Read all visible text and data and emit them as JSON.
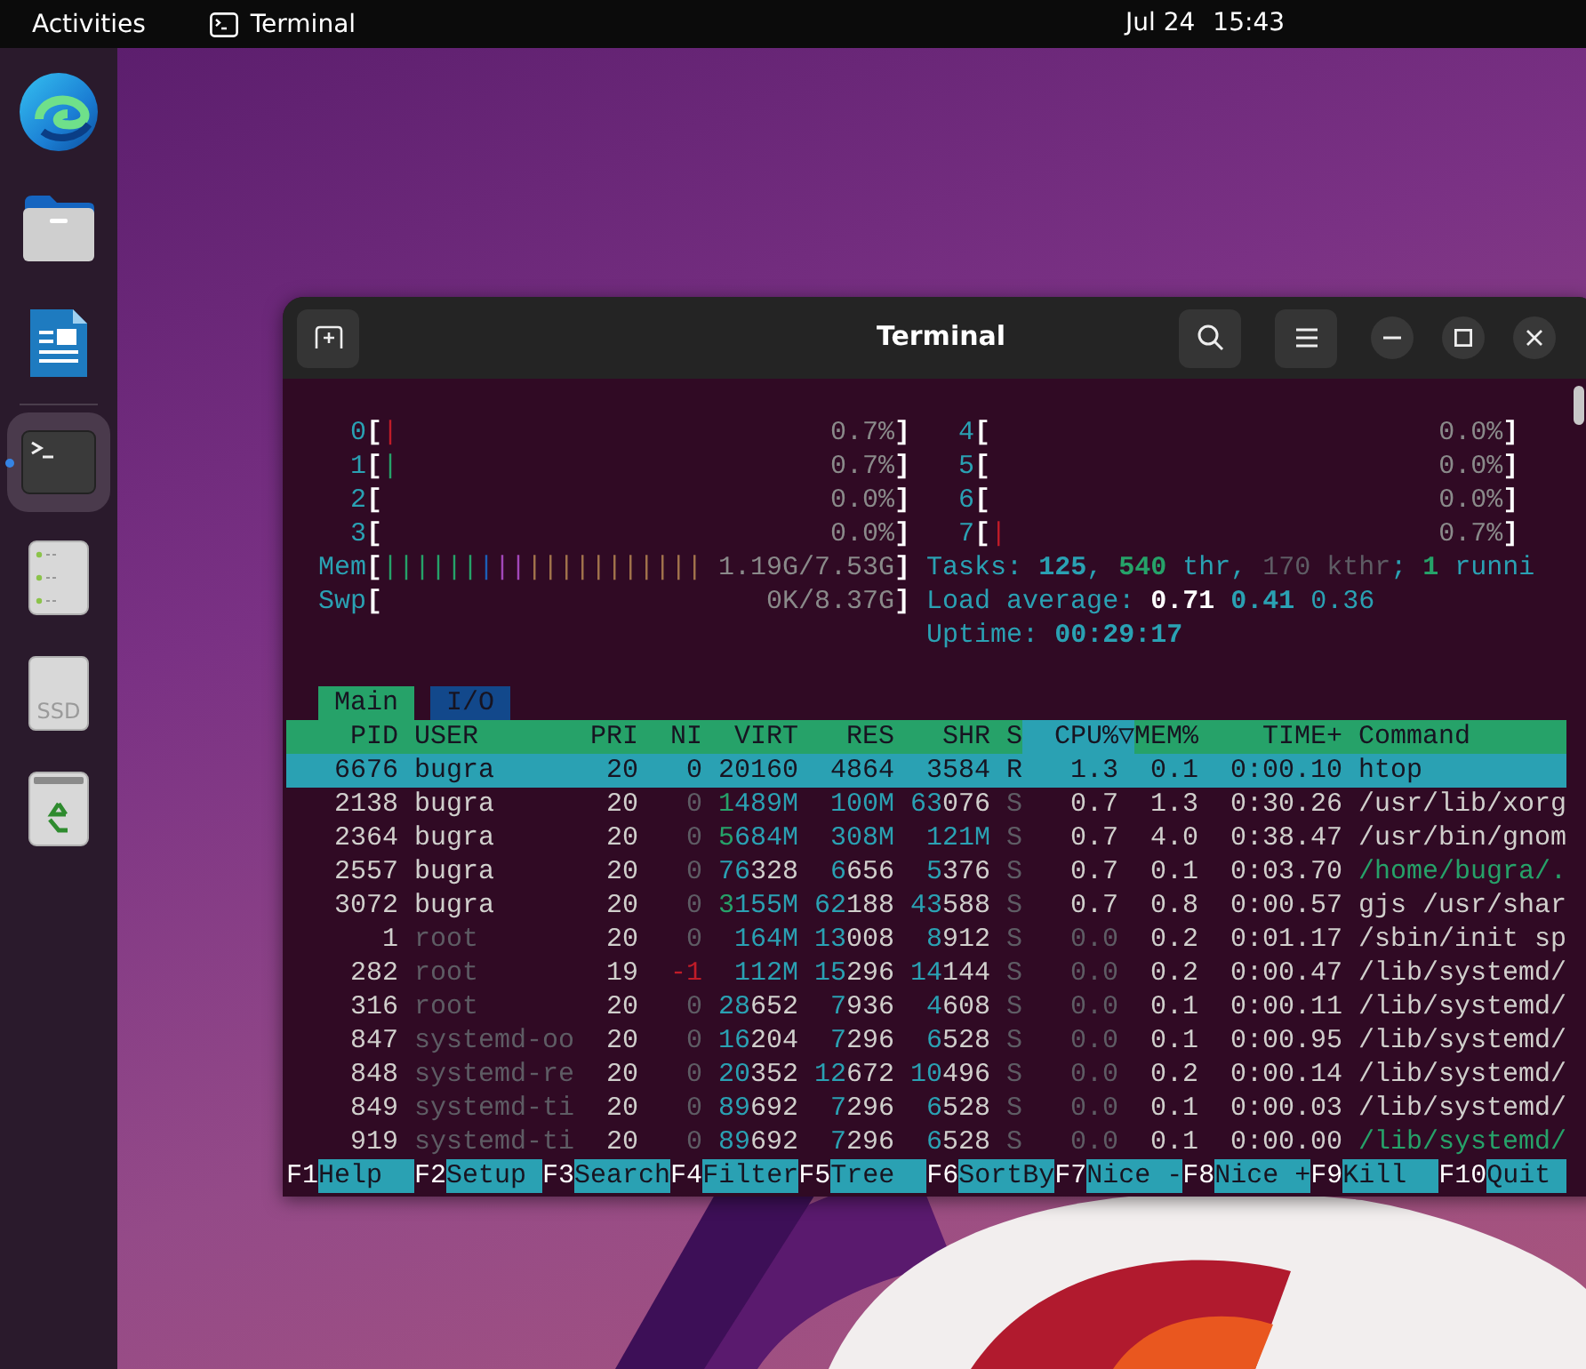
{
  "top_bar": {
    "activities": "Activities",
    "app": "Terminal",
    "date": "Jul 24",
    "time": "15:43"
  },
  "dock": [
    {
      "kind": "browser",
      "running": false
    },
    {
      "kind": "files",
      "running": false
    },
    {
      "kind": "writer",
      "running": false
    },
    {
      "kind": "terminal",
      "running": true
    },
    {
      "kind": "drive",
      "running": false
    },
    {
      "kind": "ssd",
      "label": "SSD",
      "running": false
    },
    {
      "kind": "trash",
      "running": false
    }
  ],
  "window": {
    "title": "Terminal"
  },
  "meters_left": [
    {
      "label": "0",
      "open": "[",
      "close": "]",
      "reading": "0.7%",
      "segments": [
        {
          "color": "#c01c28",
          "text": "|"
        }
      ]
    },
    {
      "label": "1",
      "open": "[",
      "close": "]",
      "reading": "0.7%",
      "segments": [
        {
          "color": "#26a269",
          "text": "|"
        }
      ]
    },
    {
      "label": "2",
      "open": "[",
      "close": "]",
      "reading": "0.0%"
    },
    {
      "label": "3",
      "open": "[",
      "close": "]",
      "reading": "0.0%"
    },
    {
      "label": "Mem",
      "open": "[",
      "close": "]",
      "reading": "1.19G/7.53G",
      "segments": [
        {
          "color": "#26a269",
          "text": "||||||"
        },
        {
          "color": "#1c5fb8",
          "text": "|"
        },
        {
          "color": "#a347ba",
          "text": "||"
        },
        {
          "color": "#a2734c",
          "text": "|||||||||||"
        }
      ]
    },
    {
      "label": "Swp",
      "open": "[",
      "close": "]",
      "reading": "0K/8.37G"
    }
  ],
  "meters_right": [
    {
      "label": "4",
      "open": "[",
      "close": "]",
      "reading": "0.0%"
    },
    {
      "label": "5",
      "open": "[",
      "close": "]",
      "reading": "0.0%"
    },
    {
      "label": "6",
      "open": "[",
      "close": "]",
      "reading": "0.0%"
    },
    {
      "label": "7",
      "open": "[",
      "close": "]",
      "reading": "0.7%",
      "segments": [
        {
          "color": "#c01c28",
          "text": "|"
        }
      ]
    }
  ],
  "summary": [
    [
      {
        "text": "Tasks: ",
        "kind": "label"
      },
      {
        "text": "125",
        "kind": "value"
      },
      {
        "text": ", ",
        "kind": "label"
      },
      {
        "text": "540",
        "kind": "value_green"
      },
      {
        "text": " thr, ",
        "kind": "label"
      },
      {
        "text": "170 kthr",
        "kind": "dim"
      },
      {
        "text": "; ",
        "kind": "label"
      },
      {
        "text": "1",
        "kind": "value_green"
      },
      {
        "text": " runni",
        "kind": "label"
      }
    ],
    [
      {
        "text": "Load average: ",
        "kind": "label"
      },
      {
        "text": "0.71",
        "kind": "value_white"
      },
      {
        "text": " 0.41",
        "kind": "value"
      },
      {
        "text": " 0.36",
        "kind": "label"
      }
    ],
    [
      {
        "text": "Uptime: ",
        "kind": "label"
      },
      {
        "text": "00:29:17",
        "kind": "value"
      }
    ]
  ],
  "tabs": [
    {
      "label": "Main",
      "selected": true
    },
    {
      "label": "I/O",
      "selected": false
    }
  ],
  "columns": [
    {
      "label": "PID",
      "sorted": false
    },
    {
      "label": "USER",
      "sorted": false
    },
    {
      "label": "PRI",
      "sorted": false
    },
    {
      "label": "NI",
      "sorted": false
    },
    {
      "label": "VIRT",
      "sorted": false
    },
    {
      "label": "RES",
      "sorted": false
    },
    {
      "label": "SHR",
      "sorted": false
    },
    {
      "label": "S",
      "sorted": false
    },
    {
      "label": "CPU%▽",
      "sorted": true
    },
    {
      "label": "MEM%",
      "sorted": false
    },
    {
      "label": "TIME+",
      "sorted": false
    },
    {
      "label": "Command",
      "sorted": false
    }
  ],
  "processes": [
    {
      "pid": "6676",
      "user": "bugra",
      "pri": "20",
      "ni": "0",
      "virt": "20160",
      "res": "4864",
      "shr": "3584",
      "state": "R",
      "cpu": "1.3",
      "mem": "0.1",
      "time": "0:00.10",
      "command": "htop",
      "selected": true,
      "dimmed_user": false,
      "thread": false
    },
    {
      "pid": "2138",
      "user": "bugra",
      "pri": "20",
      "ni": "0",
      "virt": "1489M",
      "res": "100M",
      "shr": "63076",
      "state": "S",
      "cpu": "0.7",
      "mem": "1.3",
      "time": "0:30.26",
      "command": "/usr/lib/xorg",
      "selected": false,
      "dimmed_user": false,
      "thread": false
    },
    {
      "pid": "2364",
      "user": "bugra",
      "pri": "20",
      "ni": "0",
      "virt": "5684M",
      "res": "308M",
      "shr": "121M",
      "state": "S",
      "cpu": "0.7",
      "mem": "4.0",
      "time": "0:38.47",
      "command": "/usr/bin/gnom",
      "selected": false,
      "dimmed_user": false,
      "thread": false
    },
    {
      "pid": "2557",
      "user": "bugra",
      "pri": "20",
      "ni": "0",
      "virt": "76328",
      "res": "6656",
      "shr": "5376",
      "state": "S",
      "cpu": "0.7",
      "mem": "0.1",
      "time": "0:03.70",
      "command": "/home/bugra/.",
      "selected": false,
      "dimmed_user": false,
      "thread": true
    },
    {
      "pid": "3072",
      "user": "bugra",
      "pri": "20",
      "ni": "0",
      "virt": "3155M",
      "res": "62188",
      "shr": "43588",
      "state": "S",
      "cpu": "0.7",
      "mem": "0.8",
      "time": "0:00.57",
      "command": "gjs /usr/shar",
      "selected": false,
      "dimmed_user": false,
      "thread": false
    },
    {
      "pid": "1",
      "user": "root",
      "pri": "20",
      "ni": "0",
      "virt": "164M",
      "res": "13008",
      "shr": "8912",
      "state": "S",
      "cpu": "0.0",
      "mem": "0.2",
      "time": "0:01.17",
      "command": "/sbin/init sp",
      "selected": false,
      "dimmed_user": true,
      "thread": false
    },
    {
      "pid": "282",
      "user": "root",
      "pri": "19",
      "ni": "-1",
      "virt": "112M",
      "res": "15296",
      "shr": "14144",
      "state": "S",
      "cpu": "0.0",
      "mem": "0.2",
      "time": "0:00.47",
      "command": "/lib/systemd/",
      "selected": false,
      "dimmed_user": true,
      "thread": false
    },
    {
      "pid": "316",
      "user": "root",
      "pri": "20",
      "ni": "0",
      "virt": "28652",
      "res": "7936",
      "shr": "4608",
      "state": "S",
      "cpu": "0.0",
      "mem": "0.1",
      "time": "0:00.11",
      "command": "/lib/systemd/",
      "selected": false,
      "dimmed_user": true,
      "thread": false
    },
    {
      "pid": "847",
      "user": "systemd-oo",
      "pri": "20",
      "ni": "0",
      "virt": "16204",
      "res": "7296",
      "shr": "6528",
      "state": "S",
      "cpu": "0.0",
      "mem": "0.1",
      "time": "0:00.95",
      "command": "/lib/systemd/",
      "selected": false,
      "dimmed_user": true,
      "thread": false
    },
    {
      "pid": "848",
      "user": "systemd-re",
      "pri": "20",
      "ni": "0",
      "virt": "20352",
      "res": "12672",
      "shr": "10496",
      "state": "S",
      "cpu": "0.0",
      "mem": "0.2",
      "time": "0:00.14",
      "command": "/lib/systemd/",
      "selected": false,
      "dimmed_user": true,
      "thread": false
    },
    {
      "pid": "849",
      "user": "systemd-ti",
      "pri": "20",
      "ni": "0",
      "virt": "89692",
      "res": "7296",
      "shr": "6528",
      "state": "S",
      "cpu": "0.0",
      "mem": "0.1",
      "time": "0:00.03",
      "command": "/lib/systemd/",
      "selected": false,
      "dimmed_user": true,
      "thread": false
    },
    {
      "pid": "919",
      "user": "systemd-ti",
      "pri": "20",
      "ni": "0",
      "virt": "89692",
      "res": "7296",
      "shr": "6528",
      "state": "S",
      "cpu": "0.0",
      "mem": "0.1",
      "time": "0:00.00",
      "command": "/lib/systemd/",
      "selected": false,
      "dimmed_user": true,
      "thread": true
    }
  ],
  "function_keys": [
    {
      "key": "F1",
      "label": "Help"
    },
    {
      "key": "F2",
      "label": "Setup"
    },
    {
      "key": "F3",
      "label": "Search"
    },
    {
      "key": "F4",
      "label": "Filter"
    },
    {
      "key": "F5",
      "label": "Tree"
    },
    {
      "key": "F6",
      "label": "SortBy"
    },
    {
      "key": "F7",
      "label": "Nice -"
    },
    {
      "key": "F8",
      "label": "Nice +"
    },
    {
      "key": "F9",
      "label": "Kill"
    },
    {
      "key": "F10",
      "label": "Quit"
    }
  ]
}
